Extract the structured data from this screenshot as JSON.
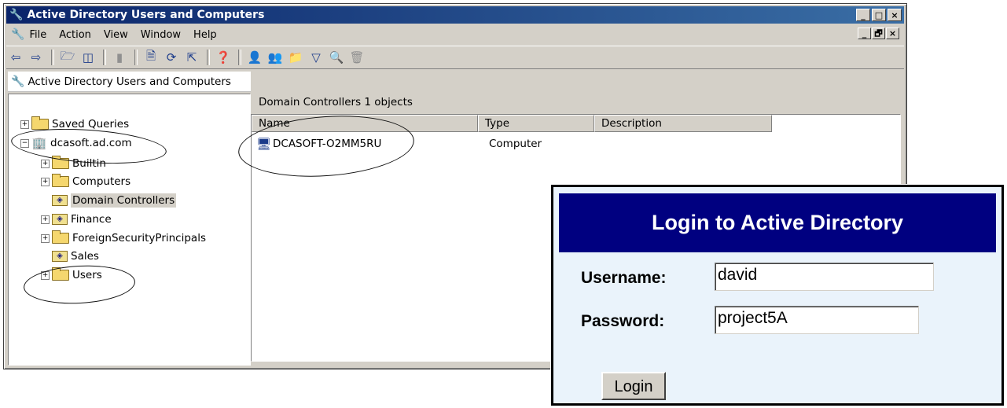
{
  "window": {
    "title": "Active Directory Users and Computers",
    "controls": [
      "_",
      "□",
      "×"
    ],
    "mdi_controls": [
      "_",
      "🗗",
      "×"
    ]
  },
  "menubar": {
    "items": [
      {
        "label": "File"
      },
      {
        "label": "Action"
      },
      {
        "label": "View"
      },
      {
        "label": "Window"
      },
      {
        "label": "Help"
      }
    ]
  },
  "toolbar": {
    "buttons": [
      "back-arrow",
      "forward-arrow",
      "up-folder",
      "show-tree",
      "delete",
      "properties",
      "refresh",
      "export-list",
      "help",
      "new-user",
      "new-group",
      "new-ou",
      "filter",
      "find",
      "add-to-group"
    ]
  },
  "tree": {
    "root": "Active Directory Users and Computers",
    "nodes": [
      {
        "label": "Saved Queries"
      },
      {
        "label": "dcasoft.ad.com"
      },
      {
        "label": "Builtin"
      },
      {
        "label": "Computers"
      },
      {
        "label": "Domain Controllers"
      },
      {
        "label": "Finance"
      },
      {
        "label": "ForeignSecurityPrincipals"
      },
      {
        "label": "Sales"
      },
      {
        "label": "Users"
      }
    ]
  },
  "details": {
    "header": "Domain Controllers   1 objects",
    "columns": [
      "Name",
      "Type",
      "Description"
    ],
    "rows": [
      {
        "name": "DCASOFT-O2MM5RU",
        "type": "Computer",
        "description": ""
      }
    ]
  },
  "login": {
    "title": "Login to Active Directory",
    "username_label": "Username:",
    "username_value": "david",
    "password_label": "Password:",
    "password_value": "project5A",
    "button": "Login"
  }
}
